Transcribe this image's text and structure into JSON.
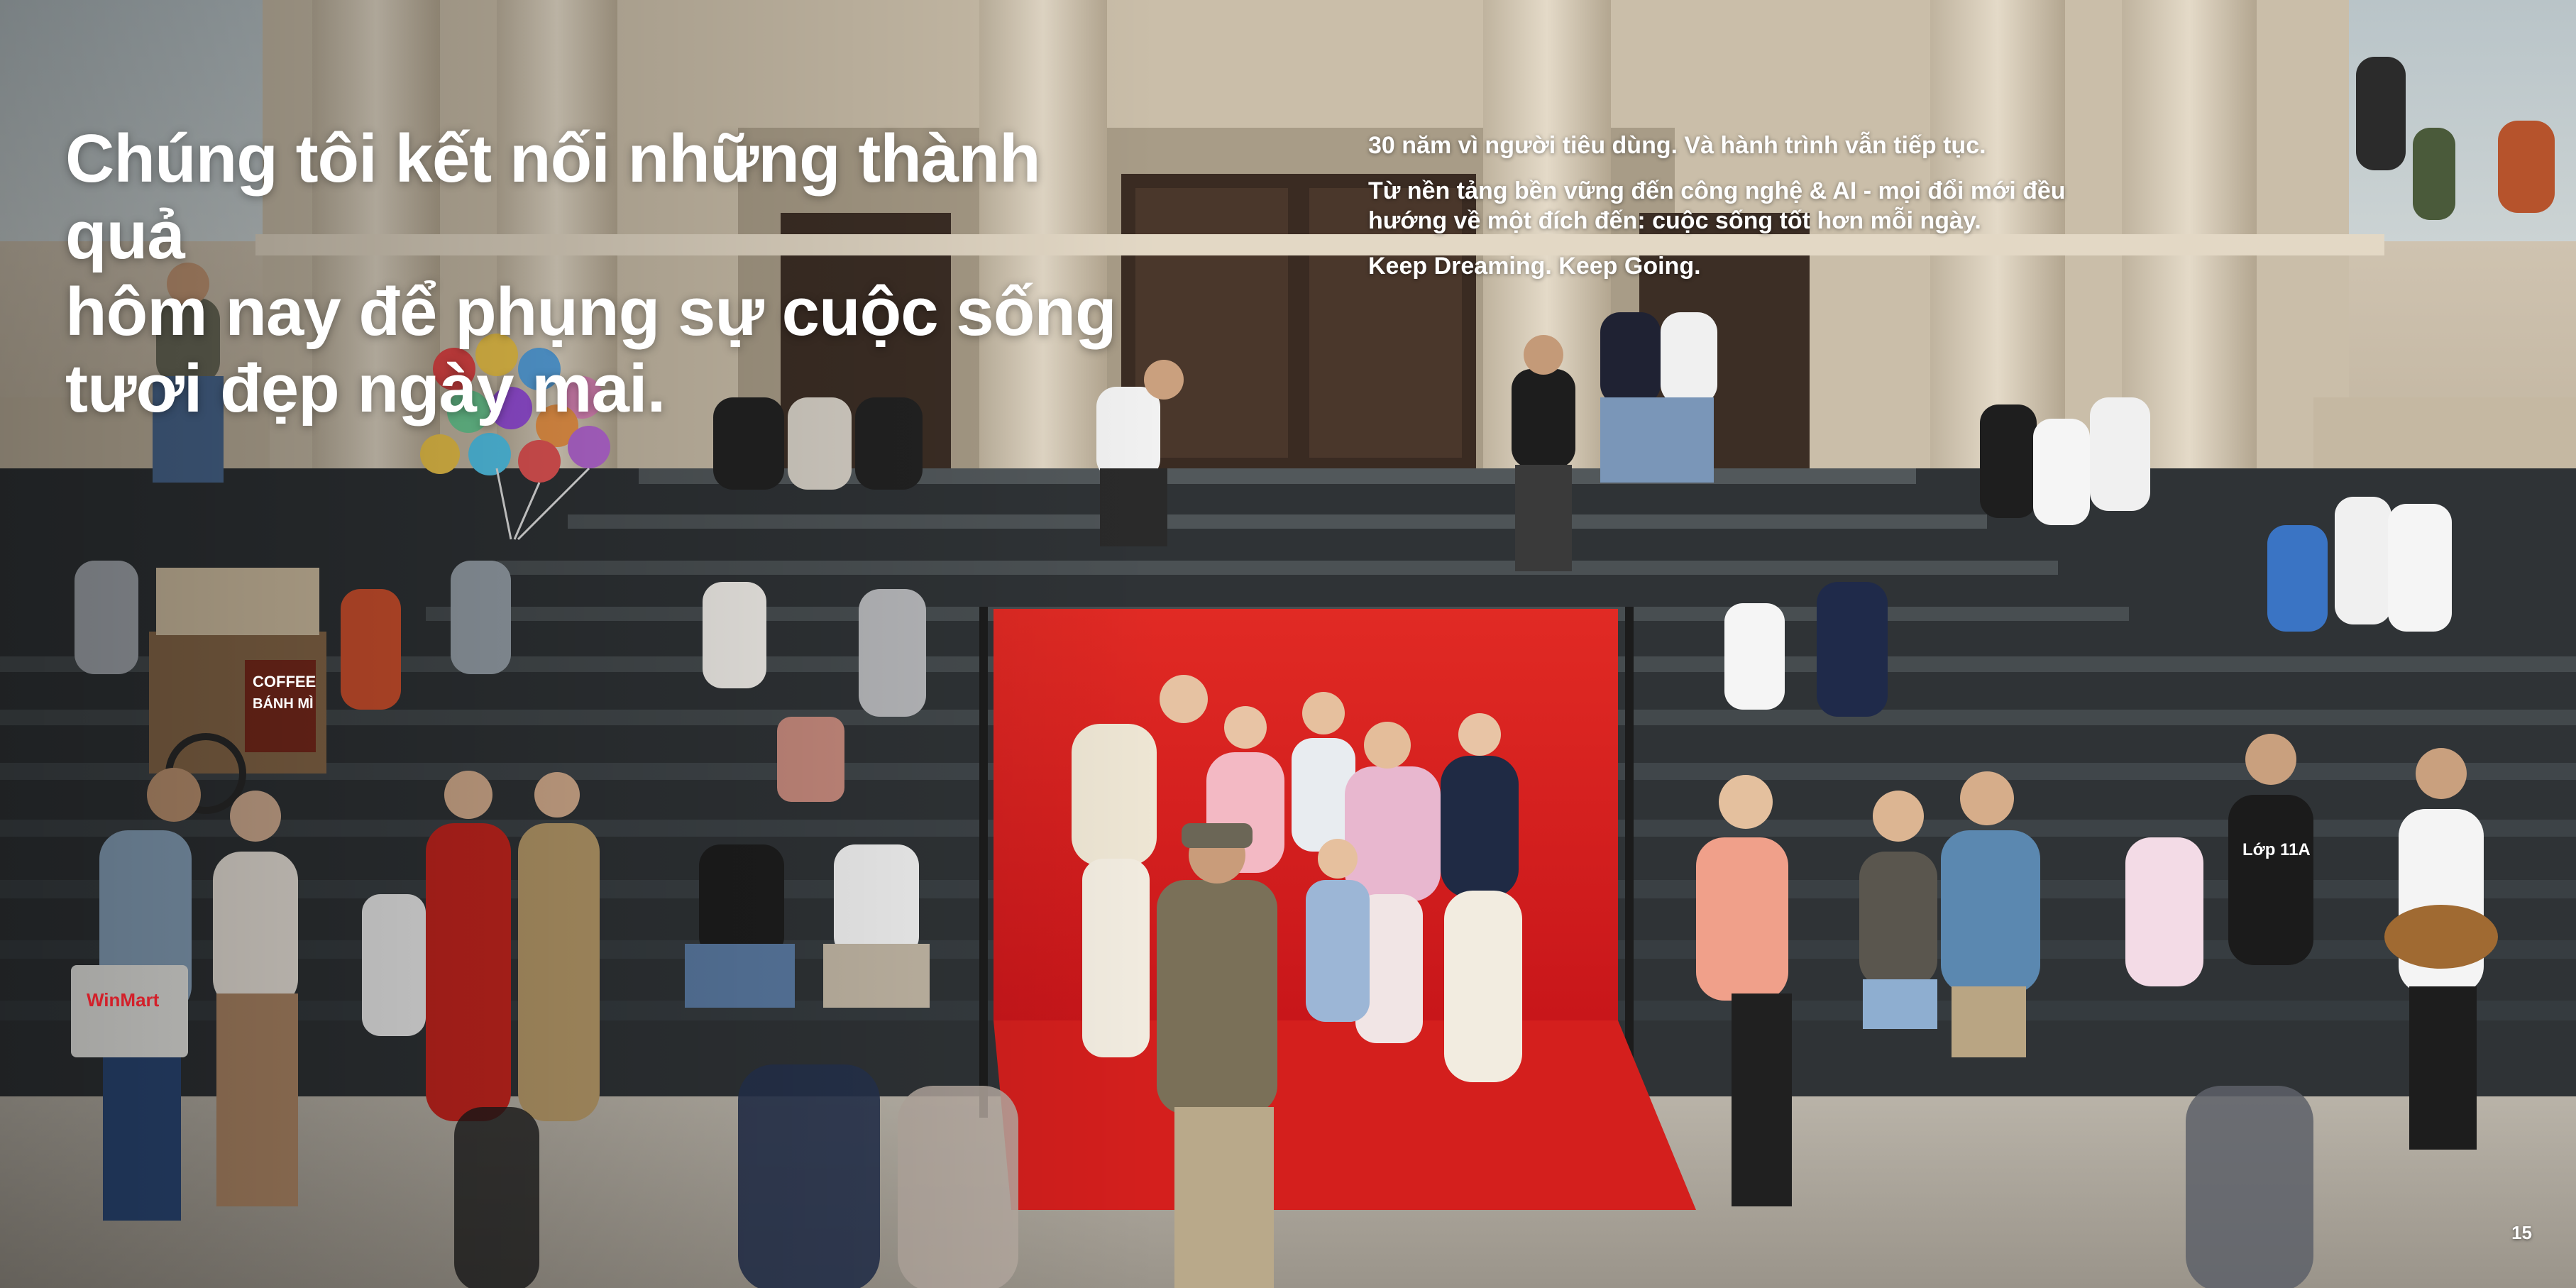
{
  "headline": {
    "lines": [
      "Chúng tôi kết nối những thành quả",
      "hôm nay để phụng sự cuộc sống",
      "tươi đẹp ngày mai."
    ]
  },
  "intro": {
    "paragraph_1": "30 năm vì người tiêu dùng. Và hành trình vẫn tiếp tục.",
    "paragraph_2_lines": [
      "Từ nền tảng bền vững đến công nghệ & AI - mọi đổi mới đều",
      "hướng về một đích đến: cuộc sống tốt hơn mỗi ngày."
    ],
    "paragraph_3": "Keep Dreaming. Keep Going."
  },
  "scene": {
    "cart_sign_1": "COFFEE",
    "cart_sign_2": "BÁNH MÌ",
    "bag_logo": "WinMart",
    "shirt_text": "Lớp 11A",
    "colors": {
      "backdrop_red": "#d81e1e",
      "building_stone": "#d9cdbb",
      "stairs_dark": "#2f3336",
      "plaza": "#a8a297"
    }
  },
  "page_number": "15"
}
